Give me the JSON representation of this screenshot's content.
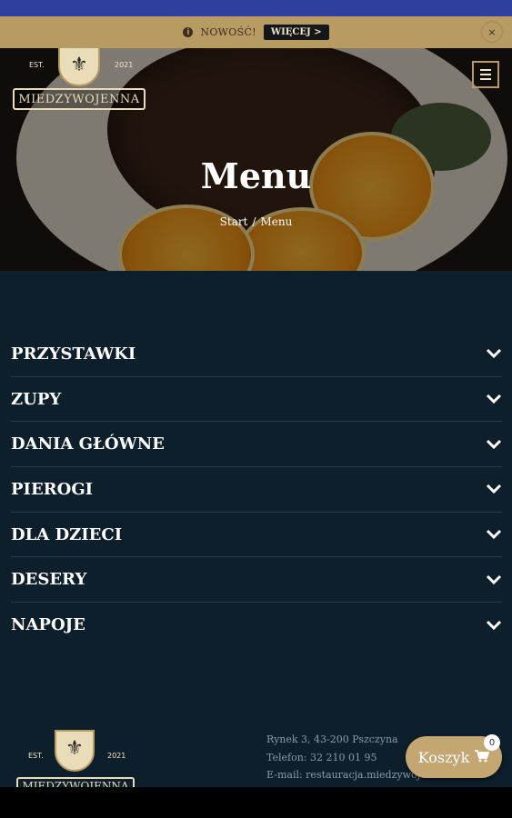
{
  "notice": {
    "text": "NOWOŚĆ!",
    "more_label": "WIĘCEJ >",
    "close_label": "×",
    "info_icon": "i"
  },
  "header": {
    "logo_text": "MIEDZYWOJENNA",
    "logo_est": "EST.",
    "logo_year": "2021",
    "menu_icon": "hamburger-icon"
  },
  "hero": {
    "title": "Menu",
    "breadcrumb": {
      "home": "Start",
      "separator": "/",
      "current": "Menu"
    }
  },
  "menu": {
    "categories": [
      {
        "label": "PRZYSTAWKI"
      },
      {
        "label": "ZUPY"
      },
      {
        "label": "DANIA GŁÓWNE"
      },
      {
        "label": "PIEROGI"
      },
      {
        "label": "DLA DZIECI"
      },
      {
        "label": "DESERY"
      },
      {
        "label": "NAPOJE"
      }
    ]
  },
  "footer": {
    "logo_text": "MIEDZYWOJENNA",
    "logo_est": "EST.",
    "logo_year": "2021",
    "address": "Rynek 3, 43-200 Pszczyna",
    "phone": "Telefon: 32 210 01 95",
    "email": "E-mail: restauracja.miedzywoje"
  },
  "cart": {
    "label": "Koszyk",
    "count": "0",
    "icon": "cart-icon"
  },
  "colors": {
    "accent_gold": "#b89a63",
    "dark_bg": "#0d1f2b",
    "status_bar": "#2f3f9e"
  }
}
